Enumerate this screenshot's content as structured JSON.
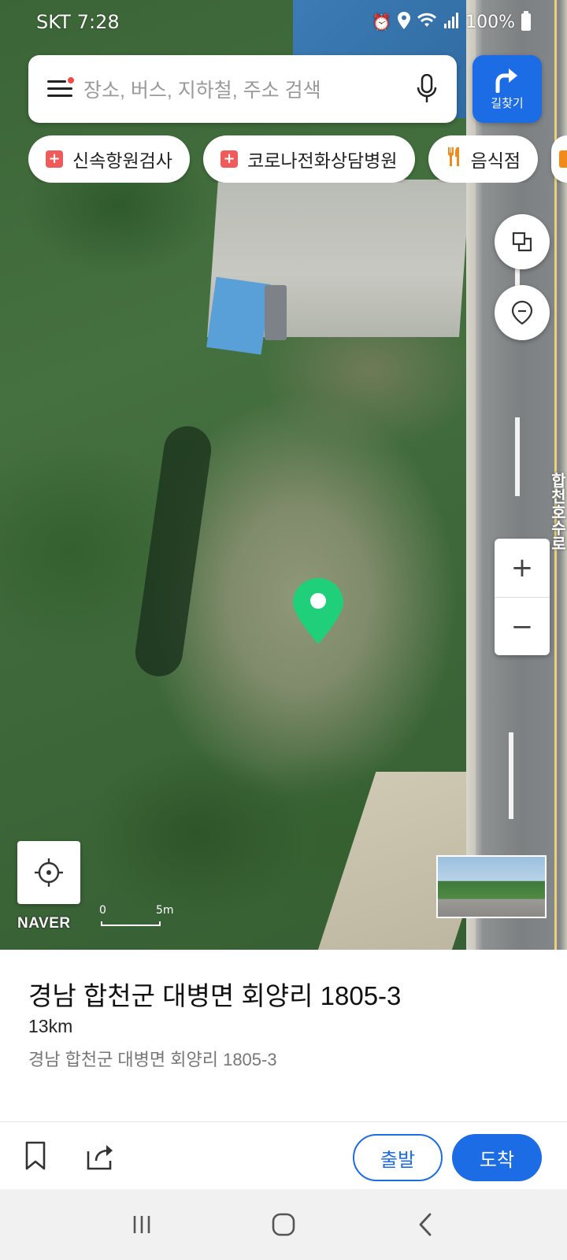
{
  "status_bar": {
    "carrier": "SKT",
    "time": "7:28",
    "battery": "100%",
    "icons": [
      "alarm-icon",
      "location-icon",
      "wifi-icon",
      "signal-icon",
      "battery-icon"
    ]
  },
  "search": {
    "placeholder": "장소, 버스, 지하철, 주소 검색",
    "directions_label": "길찾기"
  },
  "chips": [
    {
      "label": "신속항원검사",
      "icon": "medical-cross-icon"
    },
    {
      "label": "코로나전화상담병원",
      "icon": "medical-cross-icon"
    },
    {
      "label": "음식점",
      "icon": "fork-knife-icon"
    }
  ],
  "map": {
    "road_label_right": "합천호수로",
    "scale_zero": "0",
    "scale_max": "5m",
    "logo": "NAVER",
    "zoom_in": "+",
    "zoom_out": "−"
  },
  "place": {
    "title": "경남 합천군 대병면 회양리 1805-3",
    "distance": "13km",
    "address": "경남 합천군 대병면 회양리 1805-3"
  },
  "actions": {
    "start_label": "출발",
    "arrive_label": "도착"
  },
  "colors": {
    "accent": "#1c6ce5",
    "pin": "#1fcf7a",
    "chip_cross": "#ef5a5a",
    "chip_food": "#f08a1a"
  }
}
